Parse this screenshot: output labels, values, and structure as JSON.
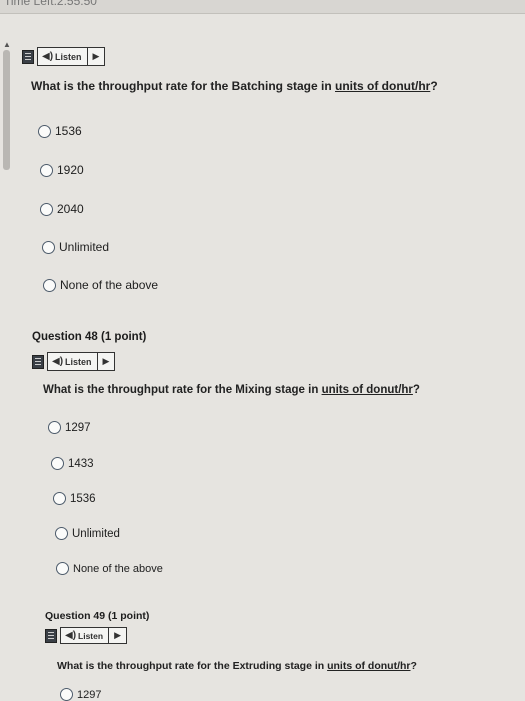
{
  "topbar": {
    "text": "Time Left:2:55:50"
  },
  "questions": [
    {
      "listen_label": "Listen",
      "text_prefix": "What is the throughput rate for the Batching stage in ",
      "text_underlined": "units of donut/hr",
      "text_suffix": "?",
      "options": [
        "1536",
        "1920",
        "2040",
        "Unlimited",
        "None of the above"
      ]
    },
    {
      "header": "Question 48 (1 point)",
      "listen_label": "Listen",
      "text_prefix": "What is the throughput rate for the Mixing stage in ",
      "text_underlined": "units of donut/hr",
      "text_suffix": "?",
      "options": [
        "1297",
        "1433",
        "1536",
        "Unlimited",
        "None of the above"
      ]
    },
    {
      "header": "Question 49 (1 point)",
      "listen_label": "Listen",
      "text_prefix": "What is the throughput rate for the Extruding stage in ",
      "text_underlined": "units of donut/hr",
      "text_suffix": "?",
      "options": [
        "1297"
      ]
    }
  ]
}
